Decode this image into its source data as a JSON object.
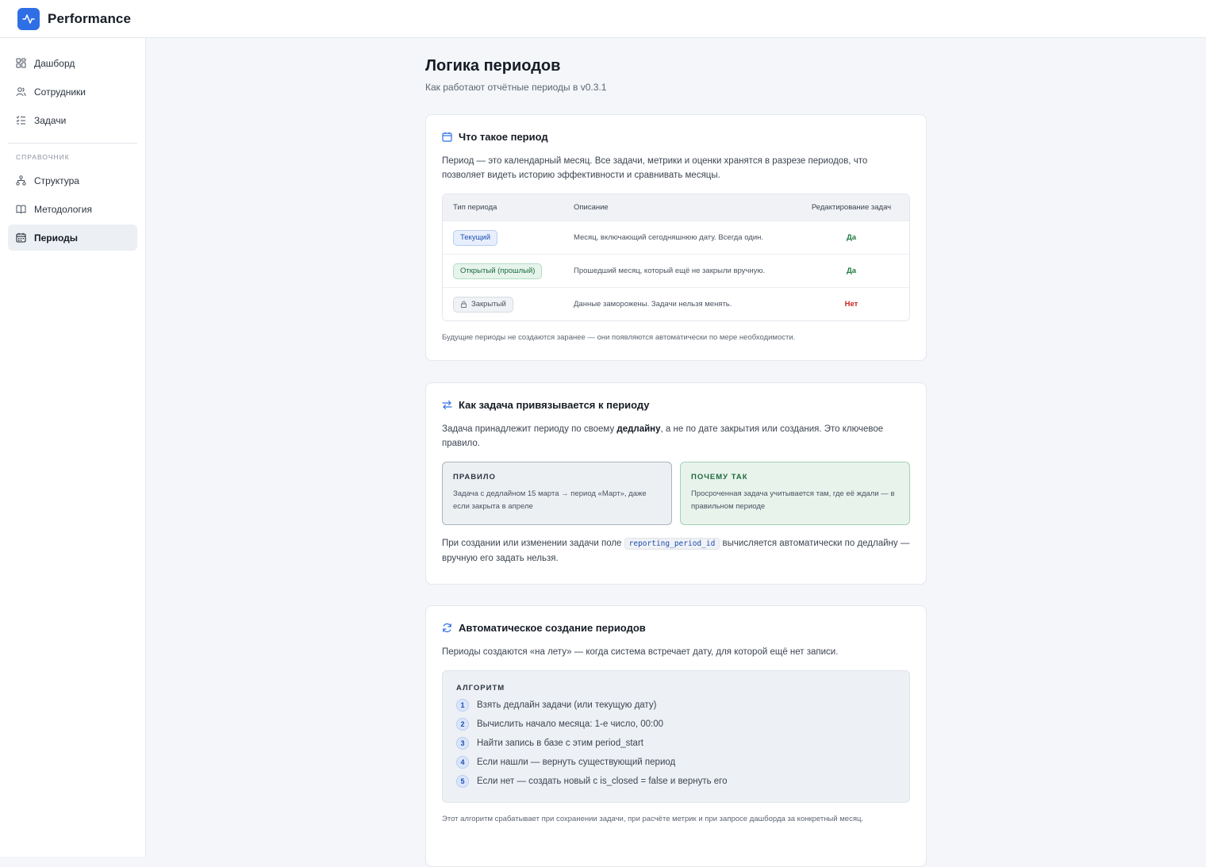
{
  "app": {
    "title": "Performance"
  },
  "sidebar": {
    "items": [
      {
        "label": "Дашборд",
        "icon": "dashboard-icon"
      },
      {
        "label": "Сотрудники",
        "icon": "users-icon"
      },
      {
        "label": "Задачи",
        "icon": "tasks-icon"
      }
    ],
    "section_label": "Справочник",
    "ref_items": [
      {
        "label": "Структура",
        "icon": "structure-icon"
      },
      {
        "label": "Методология",
        "icon": "book-icon"
      },
      {
        "label": "Периоды",
        "icon": "calendar-icon",
        "active": true
      }
    ]
  },
  "page": {
    "title": "Логика периодов",
    "subtitle": "Как работают отчётные периоды в v0.3.1"
  },
  "card1": {
    "title": "Что такое период",
    "text": "Период — это календарный месяц. Все задачи, метрики и оценки хранятся в разрезе периодов, что позволяет видеть историю эффективности и сравнивать месяцы.",
    "table": {
      "headers": [
        "Тип периода",
        "Описание",
        "Редактирование задач"
      ],
      "rows": [
        {
          "type": "Текущий",
          "desc": "Месяц, включающий сегодняшнюю дату. Всегда один.",
          "edit": "Да"
        },
        {
          "type": "Открытый (прошлый)",
          "desc": "Прошедший месяц, который ещё не закрыли вручную.",
          "edit": "Да"
        },
        {
          "type": "Закрытый",
          "desc": "Данные заморожены. Задачи нельзя менять.",
          "edit": "Нет"
        }
      ]
    },
    "footnote": "Будущие периоды не создаются заранее — они появляются автоматически по мере необходимости."
  },
  "card2": {
    "title": "Как задача привязывается к периоду",
    "text_before": "Задача принадлежит периоду по своему ",
    "text_bold": "дедлайну",
    "text_after": ", а не по дате закрытия или создания. Это ключевое правило.",
    "rule": {
      "title": "ПРАВИЛО",
      "text": "Задача с дедлайном 15 марта → период «Март», даже если закрыта в апреле"
    },
    "why": {
      "title": "ПОЧЕМУ ТАК",
      "text": "Просроченная задача учитывается там, где её ждали — в правильном периоде"
    },
    "bottom_before": "При создании или изменении задачи поле ",
    "code": "reporting_period_id",
    "bottom_after": " вычисляется автоматически по дедлайну — вручную его задать нельзя."
  },
  "card3": {
    "title": "Автоматическое создание периодов",
    "text": "Периоды создаются «на лету» — когда система встречает дату, для которой ещё нет записи.",
    "algo_title": "АЛГОРИТМ",
    "steps": [
      "Взять дедлайн задачи (или текущую дату)",
      "Вычислить начало месяца: 1-е число, 00:00",
      "Найти запись в базе с этим period_start",
      "Если нашли — вернуть существующий период",
      "Если нет — создать новый с is_closed = false и вернуть его"
    ],
    "step_numbers": [
      "1",
      "2",
      "3",
      "4",
      "5"
    ],
    "footnote": "Этот алгоритм срабатывает при сохранении задачи, при расчёте метрик и при запросе дашборда за конкретный месяц."
  },
  "colors": {
    "accent": "#2f6fe6",
    "success": "#1d7a3f",
    "danger": "#c6281f"
  }
}
